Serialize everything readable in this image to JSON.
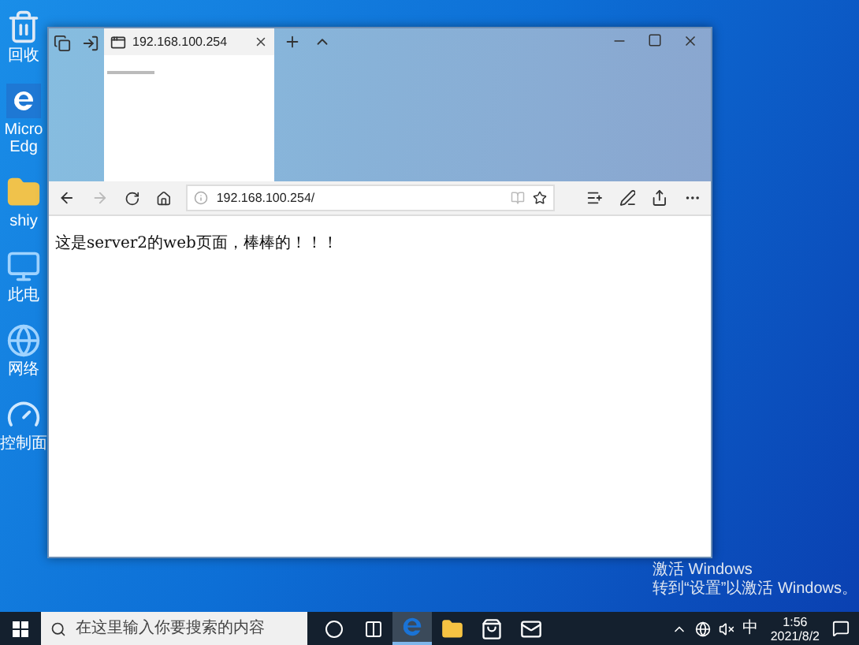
{
  "desktop": {
    "icons": [
      {
        "kind": "recycle",
        "lines": [
          "回收"
        ]
      },
      {
        "kind": "edge",
        "lines": [
          "Micro",
          "Edg"
        ]
      },
      {
        "kind": "user",
        "lines": [
          "shiy"
        ]
      },
      {
        "kind": "pc",
        "lines": [
          "此电"
        ]
      },
      {
        "kind": "network",
        "lines": [
          "网络"
        ]
      },
      {
        "kind": "control",
        "lines": [
          "控制面"
        ]
      }
    ]
  },
  "browser": {
    "tabs": [
      {
        "title": "192.168.100.254",
        "selected": true
      }
    ],
    "address": "192.168.100.254/",
    "page_text": "这是server2的web页面，棒棒的！！！"
  },
  "activation": {
    "title": "激活 Windows",
    "subtitle": "转到“设置”以激活 Windows。"
  },
  "taskbar": {
    "search": {
      "placeholder": "在这里输入你要搜索的内容"
    },
    "apps": [
      {
        "kind": "cortana",
        "selected": false
      },
      {
        "kind": "taskview",
        "selected": false
      },
      {
        "kind": "edge",
        "selected": true
      },
      {
        "kind": "explorer",
        "selected": false
      },
      {
        "kind": "store",
        "selected": false
      },
      {
        "kind": "mail",
        "selected": false
      }
    ],
    "ime": "中",
    "time": "1:56",
    "date": "2021/8/2"
  }
}
